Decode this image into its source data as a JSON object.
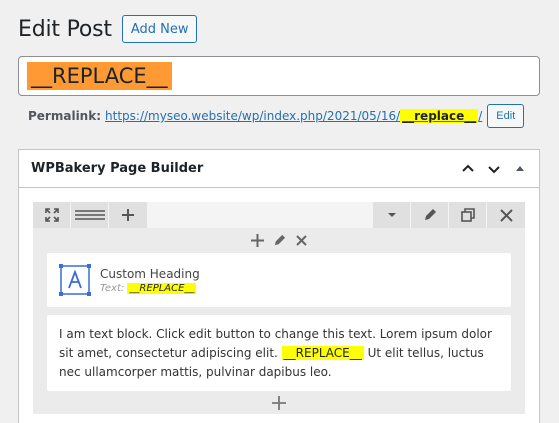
{
  "header": {
    "title": "Edit Post",
    "add_new_label": "Add New"
  },
  "title_field": {
    "value": "__REPLACE__"
  },
  "permalink": {
    "label": "Permalink:",
    "url_prefix": "https://myseo.website/wp/index.php/2021/05/16/",
    "slug": "__replace__",
    "url_suffix": "/",
    "edit_label": "Edit"
  },
  "wpbakery": {
    "title": "WPBakery Page Builder",
    "elements": {
      "heading": {
        "name": "Custom Heading",
        "param_label": "Text:",
        "param_value": "__REPLACE__"
      },
      "text_block": {
        "text_before": "I am text block. Click edit button to change this text. Lorem ipsum dolor sit amet, consectetur adipiscing elit.",
        "text_highlight": "__REPLACE__",
        "text_after": "Ut elit tellus, luctus nec ullamcorper mattis, pulvinar dapibus leo."
      }
    }
  },
  "colors": {
    "accent": "#2271b1",
    "title_highlight": "#ff9933",
    "text_highlight": "#ffff00"
  }
}
